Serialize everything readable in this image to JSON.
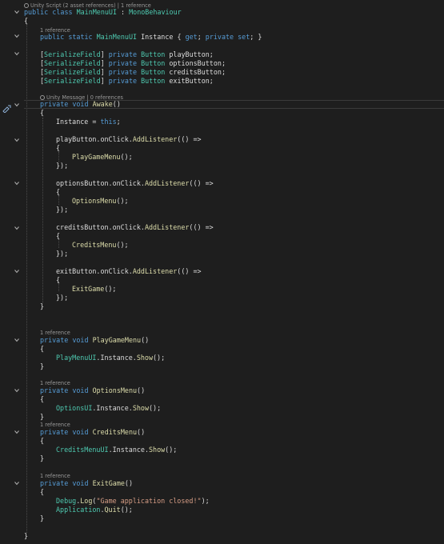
{
  "editor": {
    "language": "C#",
    "theme_colors": {
      "background": "#1e1e1e",
      "keyword": "#569cd6",
      "type": "#4ec9b0",
      "method": "#dcdcaa",
      "string": "#d69d85",
      "plain": "#dcdcdc",
      "codelens": "#999999"
    },
    "codelens": {
      "class": "Unity Script (2 asset references) | 1 reference",
      "instance": "1 reference",
      "awake": "Unity Message | 0 references",
      "play": "1 reference",
      "options": "1 reference",
      "credits": "1 reference",
      "exit": "1 reference"
    },
    "code": {
      "class_decl": {
        "k1": "public",
        "k2": "class",
        "name": "MainMenuUI",
        "sep": " : ",
        "base": "MonoBehaviour"
      },
      "brace_open": "{",
      "brace_close": "}",
      "instance_decl": {
        "k1": "public",
        "k2": "static",
        "type": "MainMenuUI",
        "name": " Instance { ",
        "get": "get",
        "mid": "; ",
        "priv": "private",
        "set": "set",
        "end": "; }"
      },
      "fields": [
        {
          "attr": "SerializeField",
          "mod": "private",
          "type": "Button",
          "name": "playButton;"
        },
        {
          "attr": "SerializeField",
          "mod": "private",
          "type": "Button",
          "name": "optionsButton;"
        },
        {
          "attr": "SerializeField",
          "mod": "private",
          "type": "Button",
          "name": "creditsButton;"
        },
        {
          "attr": "SerializeField",
          "mod": "private",
          "type": "Button",
          "name": "exitButton;"
        }
      ],
      "awake_decl": {
        "mod": "private",
        "ret": "void",
        "name": "Awake",
        "args": "()"
      },
      "instance_assign": {
        "lhs": "Instance = ",
        "kw": "this",
        "end": ";"
      },
      "listeners": [
        {
          "obj": "playButton.onClick.",
          "fn": "AddListener",
          "rest": "(() =>",
          "call": "PlayGameMenu",
          "call_end": "();",
          "close": "});"
        },
        {
          "obj": "optionsButton.onClick.",
          "fn": "AddListener",
          "rest": "(() =>",
          "call": "OptionsMenu",
          "call_end": "();",
          "close": "});"
        },
        {
          "obj": "creditsButton.onClick.",
          "fn": "AddListener",
          "rest": "(() =>",
          "call": "CreditsMenu",
          "call_end": "();",
          "close": "});"
        },
        {
          "obj": "exitButton.onClick.",
          "fn": "AddListener",
          "rest": "(() =>",
          "call": "ExitGame",
          "call_end": "();",
          "close": "});"
        }
      ],
      "methods": [
        {
          "mod": "private",
          "ret": "void",
          "name": "PlayGameMenu",
          "args": "()",
          "body_type": "PlayMenuUI",
          "body_mid": ".Instance.",
          "body_fn": "Show",
          "body_end": "();"
        },
        {
          "mod": "private",
          "ret": "void",
          "name": "OptionsMenu",
          "args": "()",
          "body_type": "OptionsUI",
          "body_mid": ".Instance.",
          "body_fn": "Show",
          "body_end": "();"
        },
        {
          "mod": "private",
          "ret": "void",
          "name": "CreditsMenu",
          "args": "()",
          "body_type": "CreditsMenuUI",
          "body_mid": ".Instance.",
          "body_fn": "Show",
          "body_end": "();"
        }
      ],
      "exit_method": {
        "mod": "private",
        "ret": "void",
        "name": "ExitGame",
        "args": "()",
        "debug_type": "Debug",
        "debug_dot": ".",
        "debug_fn": "Log",
        "debug_open": "(",
        "debug_str": "\"Game application closed!\"",
        "debug_end": ");",
        "app_type": "Application",
        "app_dot": ".",
        "app_fn": "Quit",
        "app_end": "();"
      }
    }
  }
}
